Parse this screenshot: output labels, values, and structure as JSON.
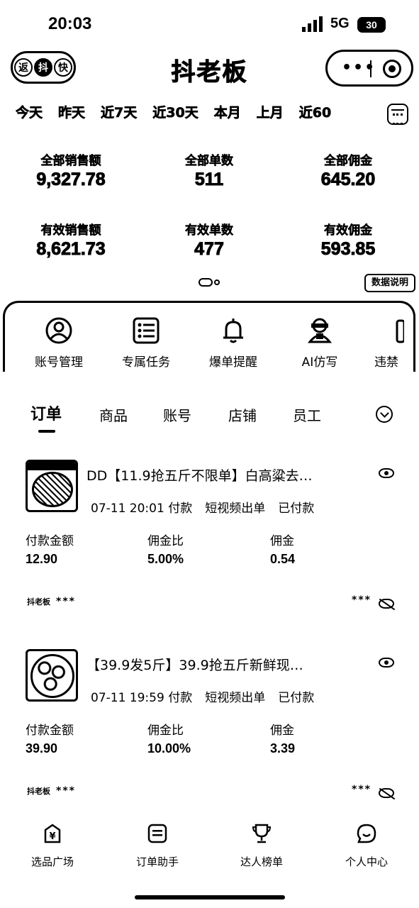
{
  "status_bar": {
    "time": "20:03",
    "network": "5G",
    "battery": "30"
  },
  "header": {
    "logo_chars": [
      "返",
      "抖",
      "快"
    ],
    "title": "抖老板",
    "capsule_more": "•••"
  },
  "date_filter": {
    "tabs": [
      "今天",
      "昨天",
      "近7天",
      "近30天",
      "本月",
      "上月",
      "近60"
    ],
    "selected": "今天"
  },
  "stats": {
    "total_sales_label": "全部销售额",
    "total_sales": "9,327.78",
    "total_orders_label": "全部单数",
    "total_orders": "511",
    "total_commission_label": "全部佣金",
    "total_commission": "645.20",
    "valid_sales_label": "有效销售额",
    "valid_sales": "8,621.73",
    "valid_orders_label": "有效单数",
    "valid_orders": "477",
    "valid_commission_label": "有效佣金",
    "valid_commission": "593.85",
    "data_note": "数据说明"
  },
  "functions": {
    "account": "账号管理",
    "tasks": "专属任务",
    "alert": "爆单提醒",
    "ai": "AI仿写",
    "banned": "违禁"
  },
  "tabs": {
    "orders": "订单",
    "products": "商品",
    "accounts": "账号",
    "shops": "店铺",
    "staff": "员工"
  },
  "orders": [
    {
      "title": "DD【11.9抢五斤不限单】白高粱去…",
      "time": "07-11 20:01 付款",
      "channel": "短视频出单",
      "status": "已付款",
      "amount_label": "付款金额",
      "amount": "12.90",
      "rate_label": "佣金比",
      "rate": "5.00%",
      "commission_label": "佣金",
      "commission": "0.54",
      "shop": "抖老板",
      "mask_left": "***",
      "mask_right": "***"
    },
    {
      "title": "【39.9发5斤】39.9抢五斤新鲜现…",
      "time": "07-11 19:59 付款",
      "channel": "短视频出单",
      "status": "已付款",
      "amount_label": "付款金额",
      "amount": "39.90",
      "rate_label": "佣金比",
      "rate": "10.00%",
      "commission_label": "佣金",
      "commission": "3.39",
      "shop": "抖老板",
      "mask_left": "***",
      "mask_right": "***"
    }
  ],
  "bottom_nav": {
    "selection": "选品广场",
    "order_helper": "订单助手",
    "ranking": "达人榜单",
    "profile": "个人中心"
  }
}
